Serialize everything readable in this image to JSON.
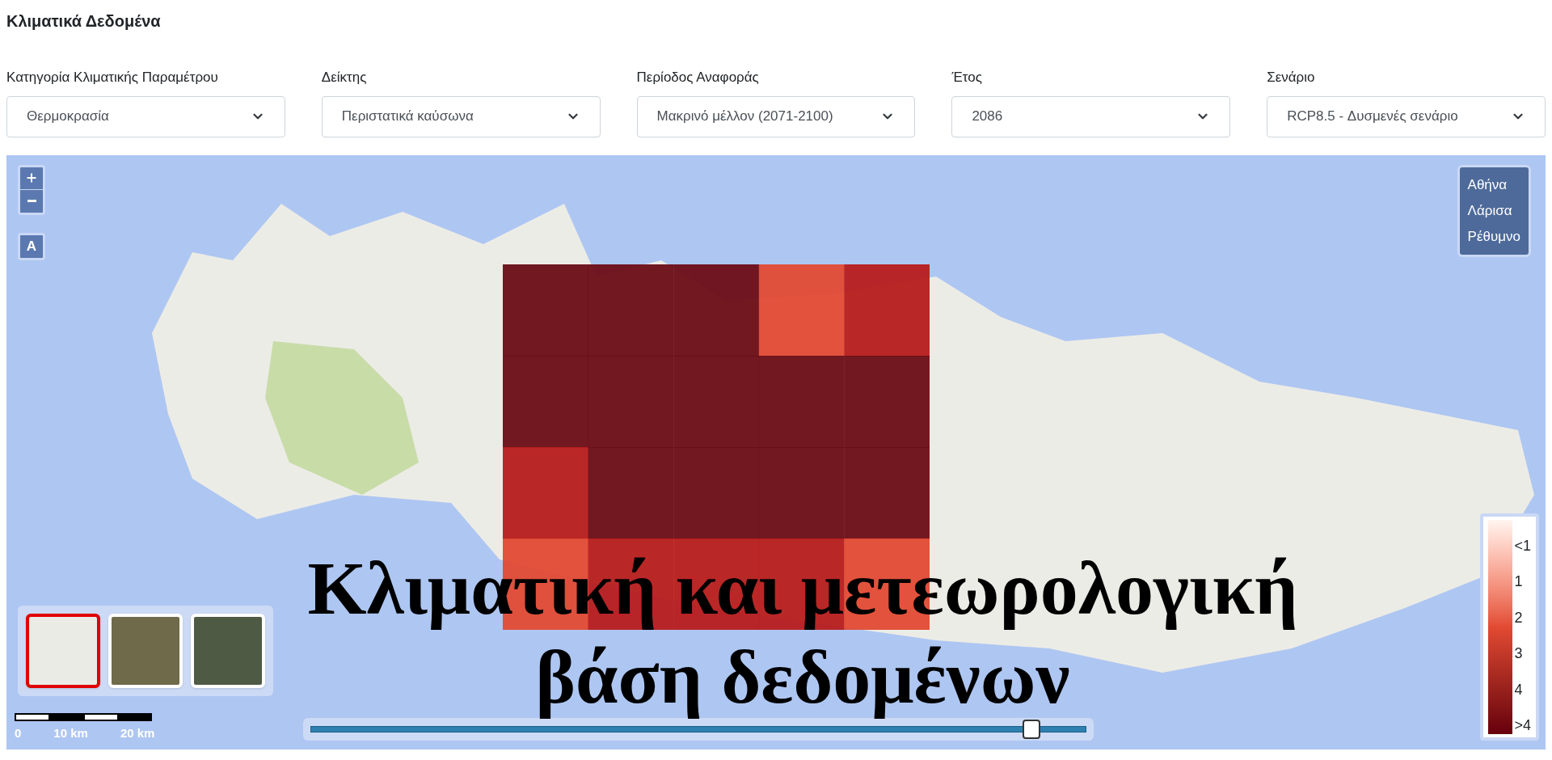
{
  "page_title": "Κλιματικά Δεδομένα",
  "filters": [
    {
      "label": "Κατηγορία Κλιματικής Παραμέτρου",
      "value": "Θερμοκρασία"
    },
    {
      "label": "Δείκτης",
      "value": "Περιστατικά καύσωνα"
    },
    {
      "label": "Περίοδος Αναφοράς",
      "value": "Μακρινό μέλλον (2071-2100)"
    },
    {
      "label": "Έτος",
      "value": "2086"
    },
    {
      "label": "Σενάριο",
      "value": "RCP8.5 - Δυσμενές σενάριο"
    }
  ],
  "map": {
    "layer_button": "A",
    "cities": [
      "Αθήνα",
      "Λάρισα",
      "Ρέθυμνο"
    ],
    "basemaps": [
      {
        "kind": "streets",
        "selected": true
      },
      {
        "kind": "satellite",
        "selected": false
      },
      {
        "kind": "hybrid",
        "selected": false
      }
    ],
    "scale_labels": [
      "0",
      "10 km",
      "20 km"
    ],
    "legend_labels": [
      "<1",
      "1",
      "2",
      "3",
      "4",
      ">4"
    ],
    "time_slider": {
      "level": 0.93
    },
    "overlay_title": [
      "Κλιματική και μετεωρολογική",
      "βάση δεδομένων"
    ]
  }
}
